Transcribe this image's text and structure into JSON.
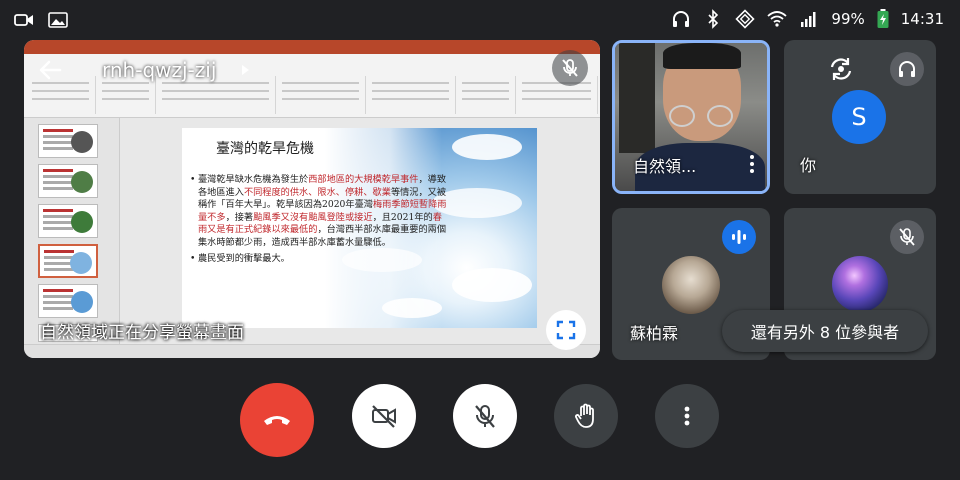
{
  "status_bar": {
    "battery": "99%",
    "time": "14:31",
    "icons": [
      "video-call-icon",
      "gallery-icon",
      "headphones-icon",
      "bluetooth-icon",
      "sync-icon",
      "wifi-icon",
      "signal-icon",
      "battery-charging-icon"
    ]
  },
  "meeting": {
    "code": "rnh-qwzj-zij",
    "share_caption": "自然領域正在分享螢幕畫面"
  },
  "shared_slide": {
    "heading": "臺灣的乾旱危機",
    "bullets": [
      [
        "臺灣乾旱缺水危機為發生於",
        "西部地區的大規模乾旱事件",
        "，導致各地區進入",
        "不同程度的供水、限水、停耕、歇業",
        "等情況，又被稱作「百年大旱」。乾旱該因為2020年臺灣",
        "梅雨季節短暫降雨量不多",
        "，接著",
        "颱風季又沒有颱風登陸或接近",
        "，且2021年的",
        "春雨又是有正式紀錄以來最低的",
        "，台灣西半部水庫最重要的兩個集水時節都少雨，造成西半部水庫蓄水量驟低。"
      ],
      [
        "農民受到的衝擊最大。"
      ]
    ]
  },
  "participants": [
    {
      "name": "自然領...",
      "type": "video"
    },
    {
      "name": "你",
      "avatar_letter": "S"
    },
    {
      "name": "蘇柏霖",
      "speaking": true
    },
    {
      "name": "",
      "muted": true
    }
  ],
  "more_participants": "還有另外 8 位參與者",
  "colors": {
    "background": "#202124",
    "tile": "#3c4043",
    "accent": "#1a73e8",
    "end_call": "#ea4335",
    "highlight": "#8ab4f8",
    "slide_red": "#c0282d"
  }
}
